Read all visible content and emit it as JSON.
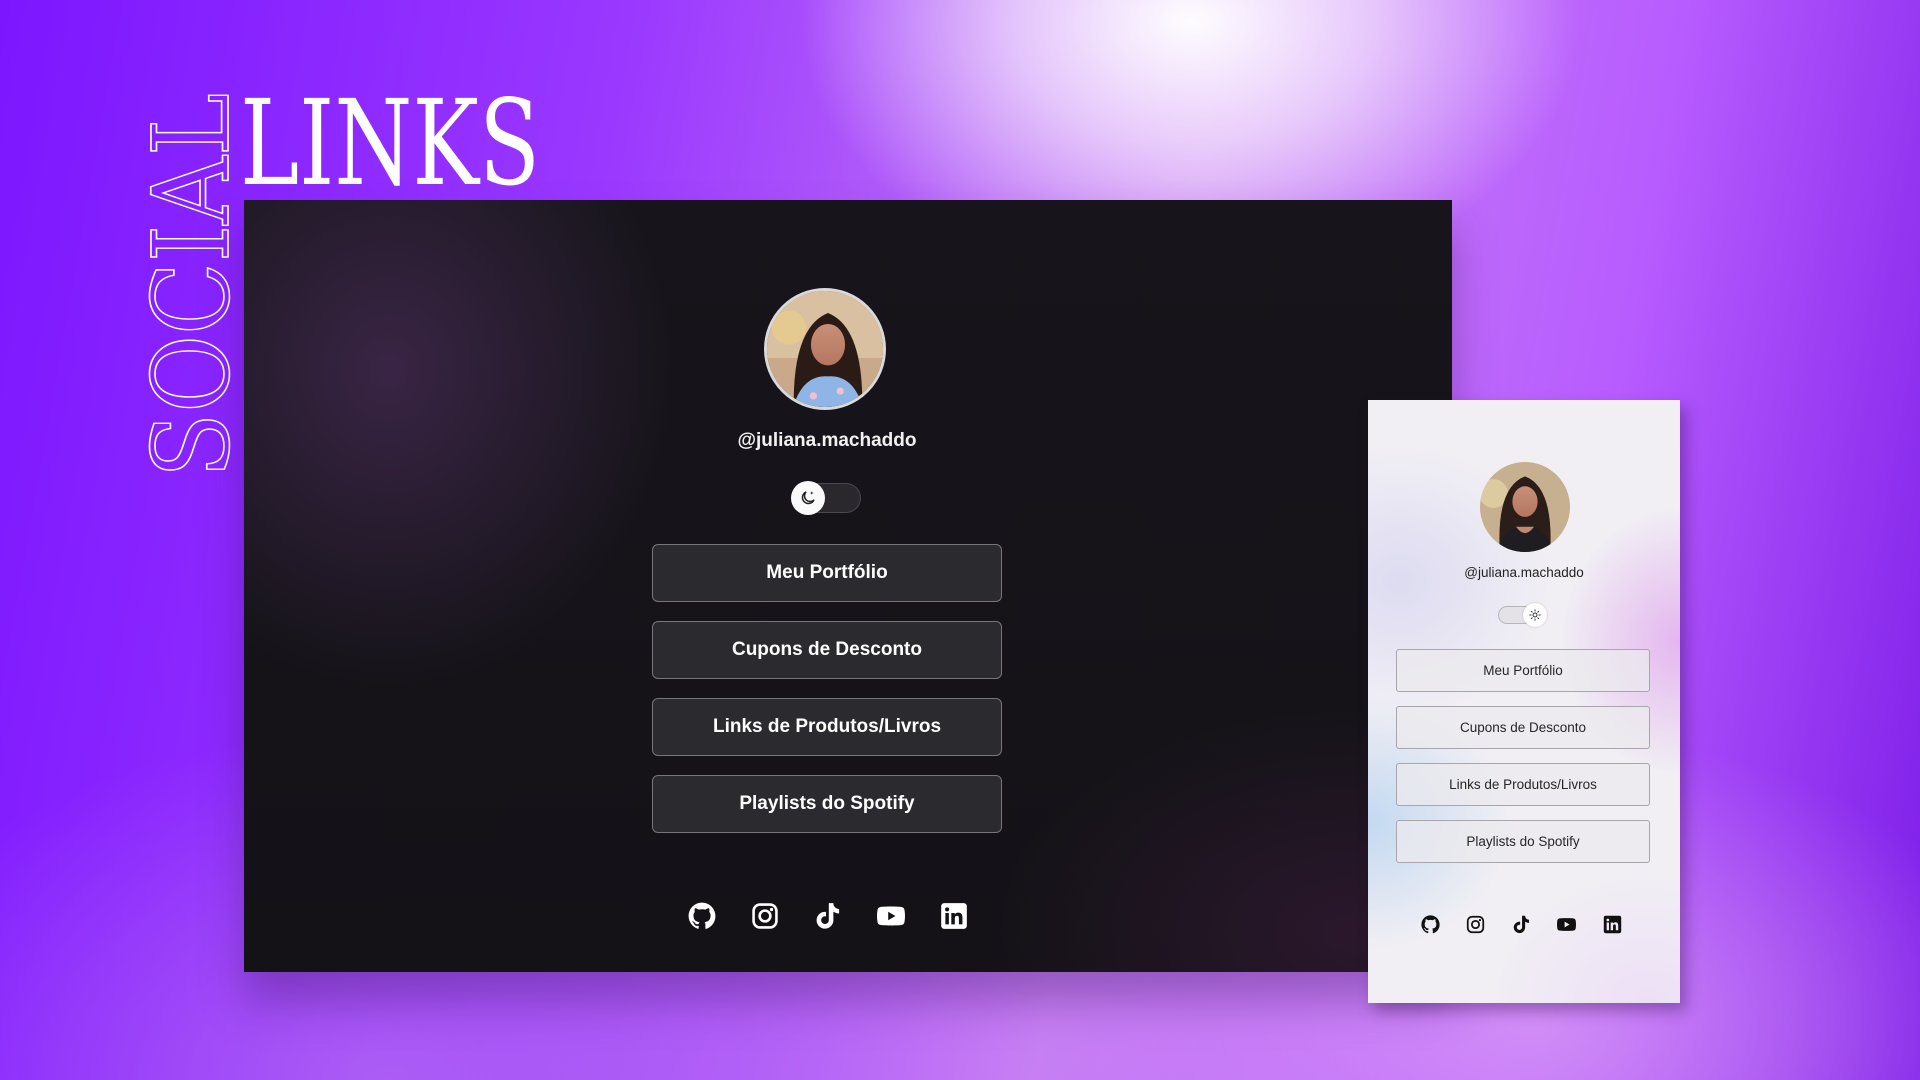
{
  "banner": {
    "title_word1": "SOCIAL",
    "title_word2": "LINKS"
  },
  "desktop": {
    "username": "@juliana.machaddo",
    "theme_toggle": {
      "state": "dark",
      "icon": "moon-icon"
    },
    "buttons": [
      {
        "label": "Meu Portfólio"
      },
      {
        "label": "Cupons de Desconto"
      },
      {
        "label": "Links de Produtos/Livros"
      },
      {
        "label": "Playlists do Spotify"
      }
    ],
    "social_icons": [
      "github-icon",
      "instagram-icon",
      "tiktok-icon",
      "youtube-icon",
      "linkedin-icon"
    ]
  },
  "mobile": {
    "username": "@juliana.machaddo",
    "theme_toggle": {
      "state": "light",
      "icon": "sun-icon"
    },
    "buttons": [
      {
        "label": "Meu Portfólio"
      },
      {
        "label": "Cupons de Desconto"
      },
      {
        "label": "Links de Produtos/Livros"
      },
      {
        "label": "Playlists do Spotify"
      }
    ],
    "social_icons": [
      "github-icon",
      "instagram-icon",
      "tiktok-icon",
      "youtube-icon",
      "linkedin-icon"
    ]
  },
  "colors": {
    "background_accent": "#8a2bff",
    "desktop_background": "#161419",
    "mobile_background": "#f1eff4"
  }
}
